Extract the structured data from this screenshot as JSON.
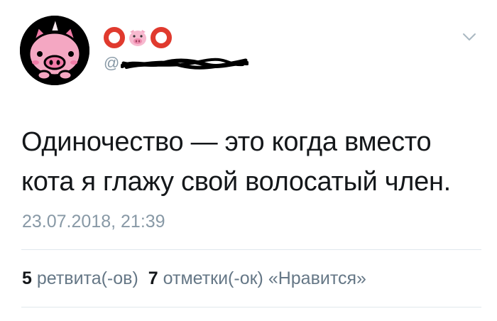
{
  "tweet": {
    "author_icons": [
      "red-ring-icon",
      "pig-face-icon",
      "red-ring-icon"
    ],
    "handle_prefix": "@",
    "text_lines": [
      "Одиночество — это когда вместо",
      "кота я глажу свой волосатый член."
    ],
    "timestamp": "23.07.2018, 21:39",
    "retweets_count": "5",
    "retweets_label": "ретвита(-ов)",
    "likes_count": "7",
    "likes_label": "отметки(-ок) «Нравится»"
  },
  "colors": {
    "text": "#14171a",
    "secondary": "#8899a6",
    "ring": "#e03a2e",
    "pig": "#f4a7c2",
    "divider": "#e1e8ed"
  }
}
